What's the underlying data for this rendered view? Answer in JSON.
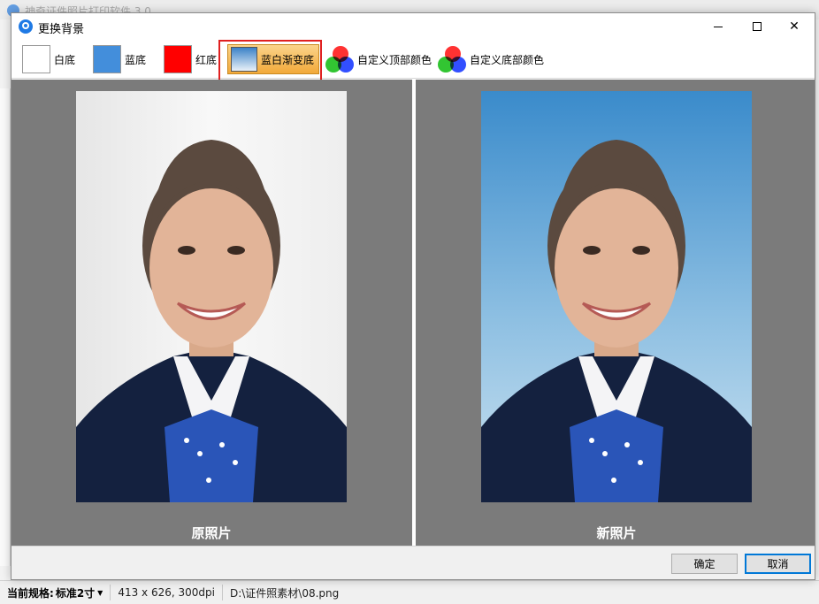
{
  "parent_window": {
    "title": "神奇证件照片打印软件 3.0"
  },
  "dialog": {
    "title": "更换背景",
    "window_controls": {
      "minimize": "minimize",
      "maximize": "maximize",
      "close": "✕"
    }
  },
  "toolbar": {
    "options": [
      {
        "label": "白底",
        "color": "#ffffff"
      },
      {
        "label": "蓝底",
        "color": "#438edb"
      },
      {
        "label": "红底",
        "color": "#ff0000"
      },
      {
        "label": "蓝白渐变底",
        "color_top": "#3c82c8",
        "color_bottom": "#e9f1f8",
        "selected": true
      },
      {
        "label": "自定义顶部颜色",
        "icon": "rgb-color-wheel-icon"
      },
      {
        "label": "自定义底部颜色",
        "icon": "rgb-color-wheel-icon"
      }
    ]
  },
  "preview": {
    "original_caption": "原照片",
    "new_caption": "新照片"
  },
  "footer": {
    "ok_label": "确定",
    "cancel_label": "取消"
  },
  "statusbar": {
    "spec_label": "当前规格:",
    "spec_value": "标准2寸",
    "image_info": "413 x 626, 300dpi",
    "file_path": "D:\\证件照素材\\08.png"
  },
  "colors": {
    "selection_highlight": "#f2a93a",
    "selection_frame": "#e02020",
    "preview_background": "#7b7b7b"
  }
}
